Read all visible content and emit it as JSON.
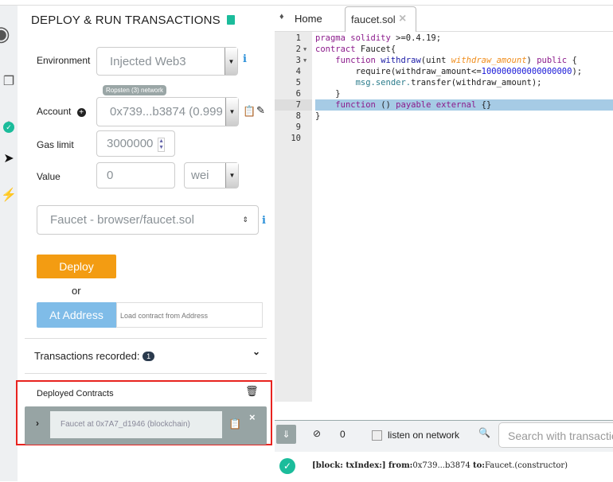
{
  "panel": {
    "title": "DEPLOY & RUN TRANSACTIONS",
    "environment_label": "Environment",
    "environment_value": "Injected Web3",
    "network_badge": "Ropsten (3) network",
    "account_label": "Account",
    "account_value": "0x739...b3874 (0.999",
    "gaslimit_label": "Gas limit",
    "gaslimit_value": "3000000",
    "value_label": "Value",
    "value_value": "0",
    "value_unit": "wei",
    "contract_select": "Faucet - browser/faucet.sol",
    "deploy_label": "Deploy",
    "or_label": "or",
    "at_address_label": "At Address",
    "at_address_placeholder": "Load contract from Address",
    "transactions_label": "Transactions recorded:",
    "transactions_count": "1",
    "deployed_label": "Deployed Contracts",
    "deployed_instance": "Faucet at 0x7A7_d1946 (blockchain)"
  },
  "tabs": [
    {
      "label": "Home"
    },
    {
      "label": "faucet.sol"
    }
  ],
  "editor": {
    "lines": [
      "1",
      "2",
      "3",
      "4",
      "5",
      "6",
      "7",
      "8",
      "9",
      "10"
    ],
    "code": {
      "l1a": "pragma solidity",
      " l1b": "",
      "l1c": " >=0.4.19;",
      "l2a": "contract",
      "l2b": " Faucet{",
      "l3a": "function",
      "l3b": " withdraw",
      "l3c": "(uint ",
      "l3d": "withdraw_amount",
      "l3e": ") ",
      "l3f": "public",
      "l3g": " {",
      "l4a": "require(withdraw_amount",
      "l4b": "<=",
      "l4c": "100000000000000000",
      "l4d": ");",
      "l5a": "msg.sender.",
      "l5b": "transfer(withdraw_amount);",
      "l6": "}",
      "l7a": "function",
      "l7b": " () ",
      "l7c": "payable external",
      "l7d": " {}",
      "l8": "}"
    }
  },
  "terminal": {
    "count": "0",
    "listen_label": "listen on network",
    "search_placeholder": "Search with transactions",
    "log_a": "[block: txIndex:]",
    "log_b": "from:",
    "log_c": "0x739...b3874 ",
    "log_d": "to:",
    "log_e": "Faucet.(constructor)"
  },
  "colors": {
    "deploy": "#f39c12",
    "at_address": "#7fbce8",
    "highlight": "#a6cbe5",
    "success": "#1bbc9b"
  }
}
